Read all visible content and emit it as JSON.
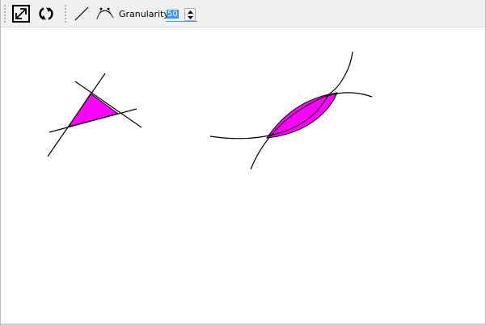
{
  "toolbar": {
    "tools": [
      {
        "name": "resize-icon"
      },
      {
        "name": "refresh-icon"
      },
      {
        "name": "line-tool-icon"
      },
      {
        "name": "curve-tool-icon"
      }
    ],
    "granularity": {
      "label": "Granularity:",
      "value": "50"
    }
  },
  "colors": {
    "fill": "#ff00ff",
    "stroke": "#000000",
    "selection": "#3399ff",
    "toolbar_bg": "#f0f0f0"
  }
}
